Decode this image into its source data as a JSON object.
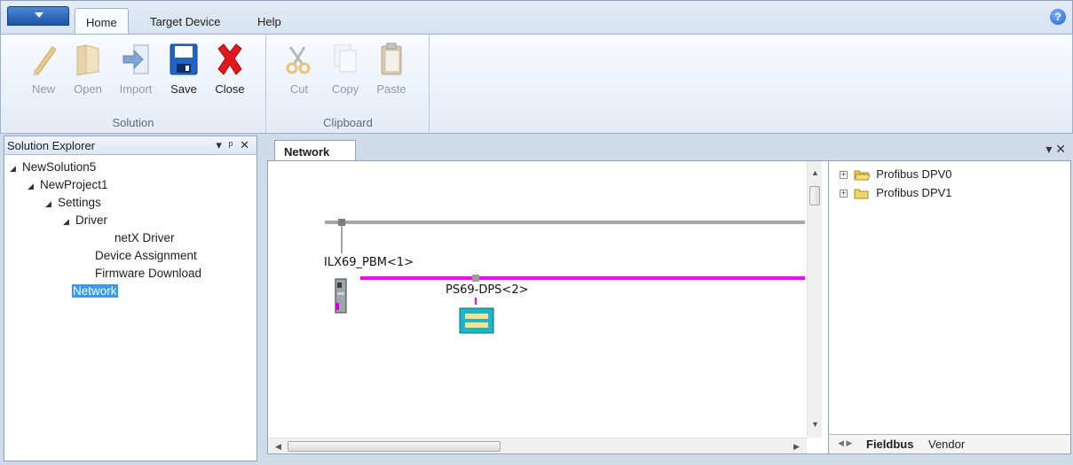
{
  "ribbon": {
    "tabs": [
      "Home",
      "Target Device",
      "Help"
    ],
    "groups": {
      "solution": {
        "label": "Solution",
        "buttons": {
          "new": "New",
          "open": "Open",
          "import": "Import",
          "save": "Save",
          "close": "Close"
        }
      },
      "clipboard": {
        "label": "Clipboard",
        "buttons": {
          "cut": "Cut",
          "copy": "Copy",
          "paste": "Paste"
        }
      }
    },
    "help_icon": "question-icon"
  },
  "explorer": {
    "title": "Solution Explorer",
    "tree": {
      "solution": "NewSolution5",
      "project": "NewProject1",
      "settings": "Settings",
      "driver": "Driver",
      "netx_driver": "netX Driver",
      "device_assignment": "Device Assignment",
      "firmware_download": "Firmware Download",
      "network": "Network"
    }
  },
  "document": {
    "tab": "Network",
    "devices": {
      "master": "ILX69_PBM<1>",
      "slave": "PS69-DPS<2>"
    },
    "colors": {
      "bus_top": "#a6a6a6",
      "bus_profibus": "#ff00ff"
    },
    "catalog": {
      "items": [
        "Profibus DPV0",
        "Profibus DPV1"
      ],
      "tabs": [
        "Fieldbus",
        "Vendor"
      ]
    }
  }
}
